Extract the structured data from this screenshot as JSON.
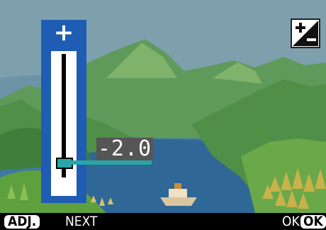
{
  "exposure": {
    "value_text": "-2.0",
    "slider_fraction": 0.0,
    "plus_glyph": "+",
    "minus_glyph": "−"
  },
  "mode_icon": "exposure-compensation-icon",
  "footer": {
    "adj_key": "ADJ.",
    "next_label": "NEXT",
    "ok_label": "OK",
    "ok_key": "OK"
  },
  "colors": {
    "panel": "#1f5cb3",
    "indicator": "#2aa6a9",
    "value_bg": "#555555"
  }
}
